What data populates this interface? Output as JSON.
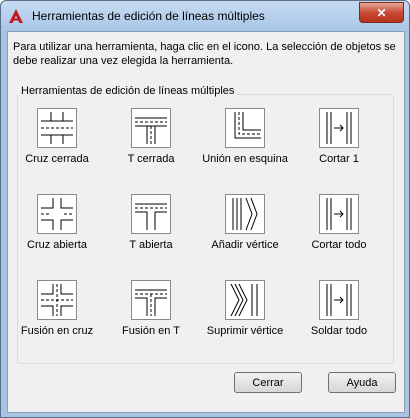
{
  "window": {
    "title": "Herramientas de edición de líneas múltiples",
    "close_symbol": "✕"
  },
  "intro_text": "Para utilizar una herramienta, haga clic en el icono. La selección de objetos se debe realizar una vez elegida la herramienta.",
  "group_label": "Herramientas de edición de líneas múltiples",
  "tools": [
    {
      "label": "Cruz cerrada",
      "icon": "closed-cross-icon"
    },
    {
      "label": "T cerrada",
      "icon": "closed-tee-icon"
    },
    {
      "label": "Unión en esquina",
      "icon": "corner-joint-icon"
    },
    {
      "label": "Cortar 1",
      "icon": "cut-single-icon"
    },
    {
      "label": "Cruz abierta",
      "icon": "open-cross-icon"
    },
    {
      "label": "T abierta",
      "icon": "open-tee-icon"
    },
    {
      "label": "Añadir vértice",
      "icon": "add-vertex-icon"
    },
    {
      "label": "Cortar todo",
      "icon": "cut-all-icon"
    },
    {
      "label": "Fusión en cruz",
      "icon": "merged-cross-icon"
    },
    {
      "label": "Fusión en T",
      "icon": "merged-tee-icon"
    },
    {
      "label": "Suprimir vértice",
      "icon": "delete-vertex-icon"
    },
    {
      "label": "Soldar todo",
      "icon": "weld-all-icon"
    }
  ],
  "buttons": {
    "close_label": "Cerrar",
    "help_label": "Ayuda"
  },
  "colors": {
    "title_bar": "#a9c6e8",
    "close_button": "#c74a34",
    "dialog_background": "#f0f0f0",
    "app_icon": "#c4161c"
  }
}
